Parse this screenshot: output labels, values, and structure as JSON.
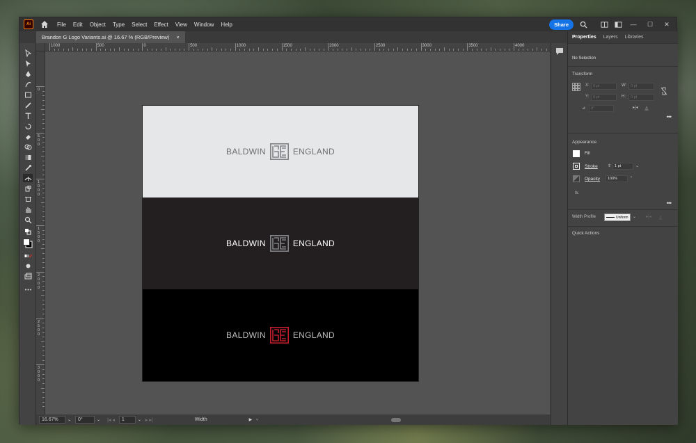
{
  "app": {
    "logo_text": "Ai",
    "menu": [
      "File",
      "Edit",
      "Object",
      "Type",
      "Select",
      "Effect",
      "View",
      "Window",
      "Help"
    ],
    "share_label": "Share",
    "window_controls": [
      "—",
      "☐",
      "✕"
    ]
  },
  "document": {
    "tab_title": "Brandon G Logo Variants.ai @ 16.67 % (RGB/Preview)",
    "tab_close": "×"
  },
  "ruler": {
    "top_labels": [
      "1000",
      "500",
      "0",
      "500",
      "1000",
      "1500",
      "2000",
      "2500",
      "3000",
      "3500",
      "4000"
    ],
    "left_labels": [
      "0",
      "500",
      "1000",
      "1500",
      "2000",
      "2500",
      "3000"
    ]
  },
  "artboard": {
    "bands": [
      {
        "left": "BALDWIN",
        "right": "ENGLAND",
        "bg": "#e6e7e8",
        "text": "#6d6e71",
        "mark": "#808285"
      },
      {
        "left": "BALDWIN",
        "right": "ENGLAND",
        "bg": "#231f20",
        "text": "#ffffff",
        "mark": "#808285"
      },
      {
        "left": "BALDWIN",
        "right": "ENGLAND",
        "bg": "#000000",
        "text": "#bcbec0",
        "mark": "#be1e2d"
      }
    ]
  },
  "status": {
    "zoom": "16.67%",
    "rotation": "0°",
    "artboard_num": "1",
    "tool_label": "Width"
  },
  "panel": {
    "tabs": [
      "Properties",
      "Layers",
      "Libraries"
    ],
    "selection": "No Selection",
    "transform_title": "Transform",
    "x_label": "X:",
    "x_value": "0 pt",
    "y_label": "Y:",
    "y_value": "0 pt",
    "w_label": "W:",
    "w_value": "0 pt",
    "h_label": "H:",
    "h_value": "0 pt",
    "angle_value": "0°",
    "appearance_title": "Appearance",
    "fill_label": "Fill",
    "stroke_label": "Stroke",
    "stroke_value": "1 pt",
    "opacity_label": "Opacity",
    "opacity_value": "100%",
    "fx_label": "fx.",
    "width_profile_label": "Width Profile",
    "width_profile_value": "Uniform",
    "quick_actions_title": "Quick Actions",
    "more": "•••"
  }
}
